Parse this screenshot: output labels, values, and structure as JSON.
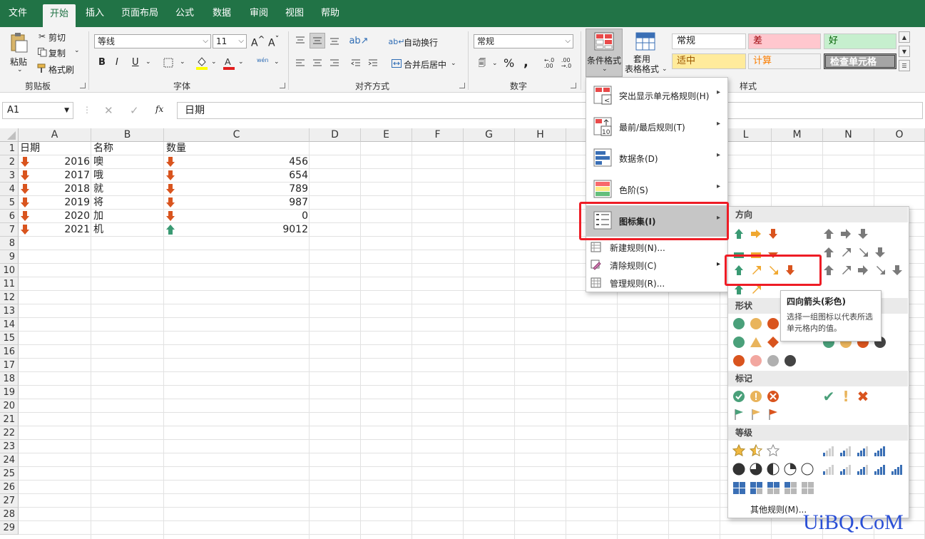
{
  "menu": {
    "tabs": [
      "文件",
      "开始",
      "插入",
      "页面布局",
      "公式",
      "数据",
      "审阅",
      "视图",
      "帮助"
    ],
    "active": "开始"
  },
  "ribbon": {
    "clipboard": {
      "paste": "粘贴",
      "cut": "剪切",
      "copy": "复制",
      "painter": "格式刷",
      "group": "剪贴板"
    },
    "font": {
      "name": "等线",
      "size": "11",
      "bold": "B",
      "italic": "I",
      "underline": "U",
      "group": "字体",
      "grow": "A",
      "shrink": "A",
      "phonetic": "wén"
    },
    "alignment": {
      "wrap": "自动换行",
      "merge": "合并后居中",
      "group": "对齐方式"
    },
    "number": {
      "format": "常规",
      "percent": "%",
      "comma": ",",
      "group": "数字"
    },
    "styles": {
      "conditional": "条件格式",
      "table": "套用\n表格格式",
      "cells": [
        {
          "label": "常规",
          "bg": "#ffffff",
          "color": "#222222"
        },
        {
          "label": "差",
          "bg": "#ffc7ce",
          "color": "#9c0006"
        },
        {
          "label": "好",
          "bg": "#c6efce",
          "color": "#006100"
        },
        {
          "label": "适中",
          "bg": "#ffeb9c",
          "color": "#9c5700"
        },
        {
          "label": "计算",
          "bg": "#f2f2f2",
          "color": "#fa7d00"
        },
        {
          "label": "检查单元格",
          "bg": "#a5a5a5",
          "color": "#ffffff"
        }
      ],
      "group": "样式"
    }
  },
  "formula": {
    "namebox": "A1",
    "fx": "fx",
    "content": "日期"
  },
  "columns": [
    "A",
    "B",
    "C",
    "D",
    "E",
    "F",
    "G",
    "H",
    "I",
    "J",
    "K",
    "L",
    "M",
    "N",
    "O"
  ],
  "rows": [
    "1",
    "2",
    "3",
    "4",
    "5",
    "6",
    "7",
    "8",
    "9",
    "10",
    "11",
    "12",
    "13",
    "14",
    "15",
    "16",
    "17",
    "18",
    "19",
    "20",
    "21",
    "22",
    "23",
    "24",
    "25",
    "26",
    "27",
    "28",
    "29"
  ],
  "sheet": {
    "headers": [
      "日期",
      "名称",
      "数量"
    ],
    "data": [
      {
        "year": "2016",
        "name": "噢",
        "qty": "456",
        "a_icon": "down",
        "c_icon": "down"
      },
      {
        "year": "2017",
        "name": "哦",
        "qty": "654",
        "a_icon": "down",
        "c_icon": "down"
      },
      {
        "year": "2018",
        "name": "就",
        "qty": "789",
        "a_icon": "down",
        "c_icon": "down"
      },
      {
        "year": "2019",
        "name": "将",
        "qty": "987",
        "a_icon": "down",
        "c_icon": "down"
      },
      {
        "year": "2020",
        "name": "加",
        "qty": "0",
        "a_icon": "down",
        "c_icon": "down"
      },
      {
        "year": "2021",
        "name": "机",
        "qty": "9012",
        "a_icon": "down",
        "c_icon": "up"
      }
    ]
  },
  "dropdown": {
    "items": [
      "突出显示单元格规则(H)",
      "最前/最后规则(T)",
      "数据条(D)",
      "色阶(S)",
      "图标集(I)"
    ],
    "small_items": [
      "新建规则(N)...",
      "清除规则(C)",
      "管理规则(R)..."
    ]
  },
  "submenu": {
    "sections": [
      "方向",
      "形状",
      "标记",
      "等级"
    ],
    "more": "其他规则(M)..."
  },
  "tooltip": {
    "title": "四向箭头(彩色)",
    "body": "选择一组图标以代表所选单元格内的值。"
  },
  "colors": {
    "green": "#217346",
    "up": "#3a9a73",
    "down": "#d9541e",
    "side": "#f0a830",
    "highlight": "#ee1c25"
  },
  "watermark": "UiBQ.CoM"
}
